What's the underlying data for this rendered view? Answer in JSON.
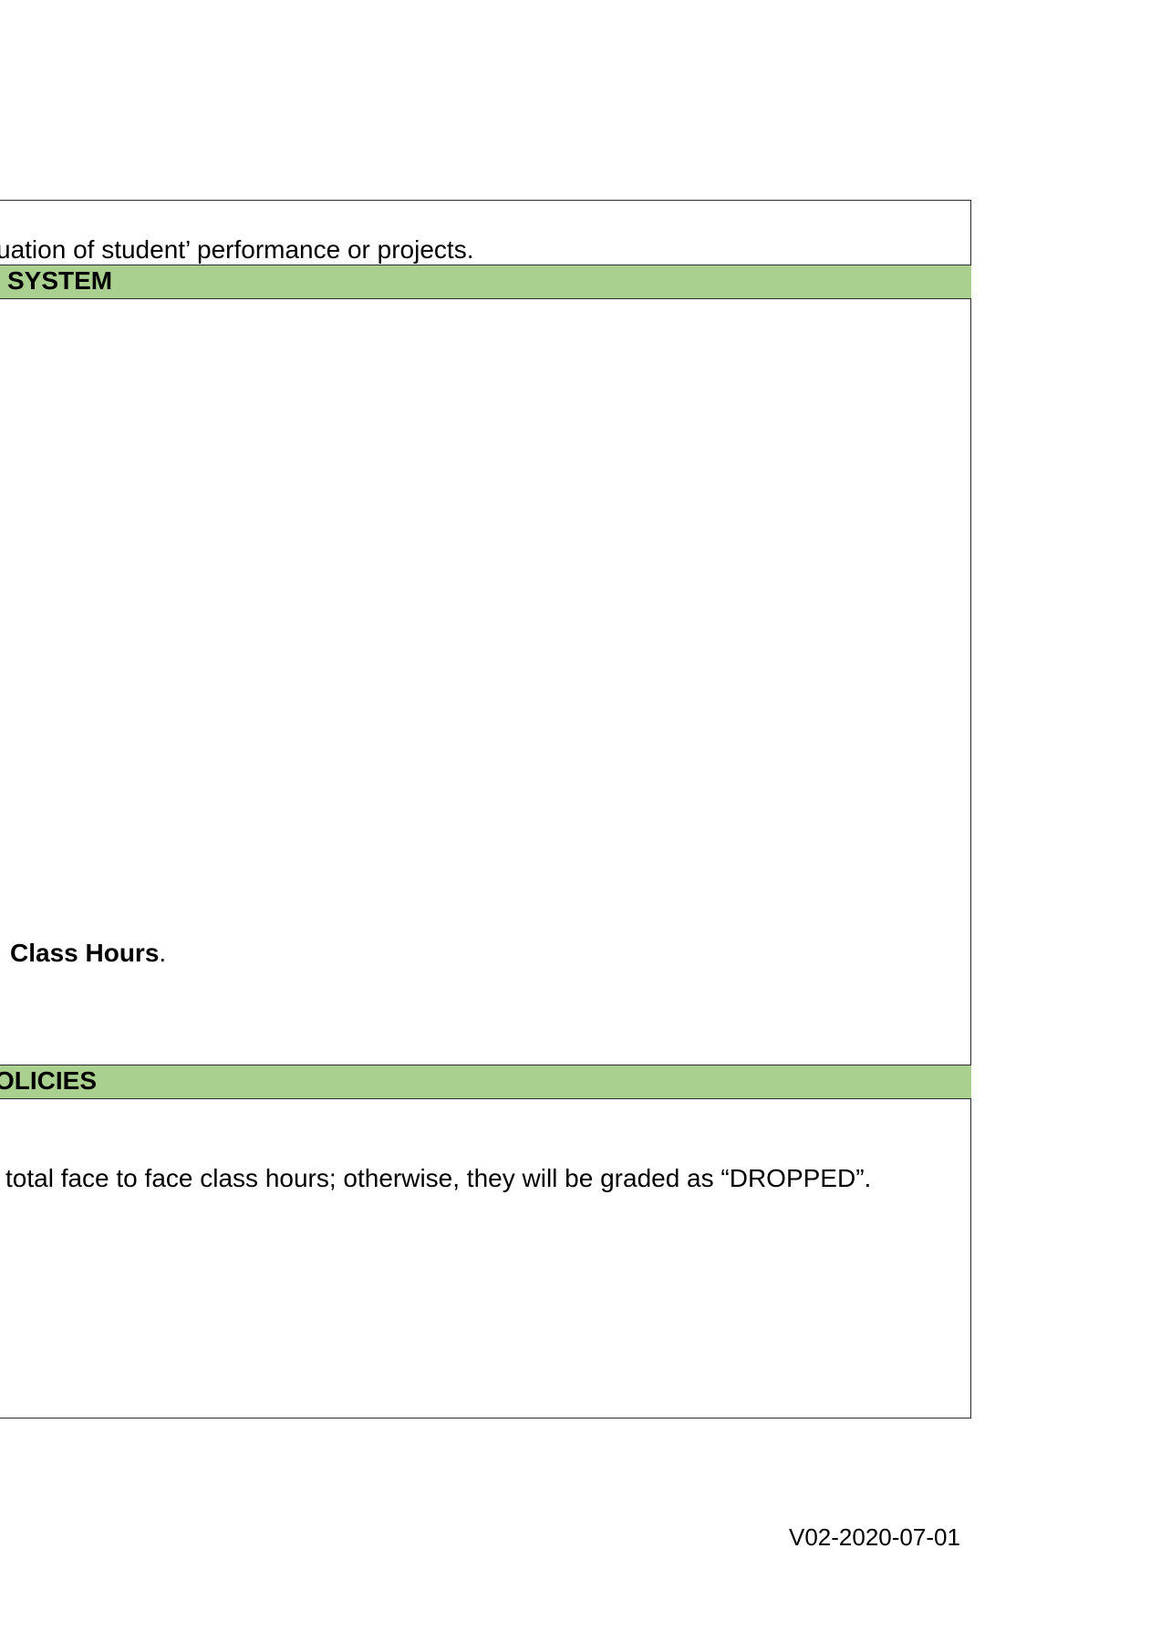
{
  "document": {
    "evaluation_text": "uation of student’ performance or projects.",
    "grading_header": "SYSTEM",
    "class_hours_bold": "Class Hours",
    "class_hours_period": ".",
    "policies_header": "OLICIES",
    "attendance_text": "total face to face class hours; otherwise, they will be graded as “DROPPED”."
  },
  "footer": {
    "version": "V02-2020-07-01"
  },
  "colors": {
    "header_band": "#a9d08e",
    "border": "#2b2b2b"
  }
}
